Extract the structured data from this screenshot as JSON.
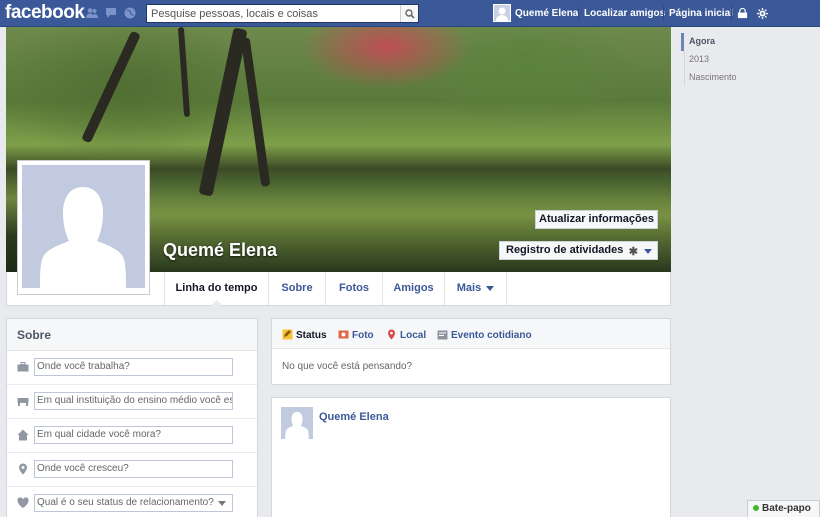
{
  "colors": {
    "brand": "#3b5998",
    "page_bg": "#e9eaed",
    "link": "#3b5998",
    "online": "#42b72a"
  },
  "topbar": {
    "logo": "facebook",
    "icons": [
      "friend-requests-icon",
      "messages-icon",
      "notifications-globe-icon"
    ],
    "search_placeholder": "Pesquise pessoas, locais e coisas",
    "user_name": "Quemé Elena",
    "find_friends": "Localizar amigos",
    "home": "Página inicial",
    "right_icons": [
      "privacy-shortcuts-icon",
      "settings-gear-icon"
    ]
  },
  "cover": {
    "update_info": "Atualizar informações",
    "activity_log": "Registro de atividades"
  },
  "profile": {
    "name": "Quemé Elena"
  },
  "tabs": [
    "Linha do tempo",
    "Sobre",
    "Fotos",
    "Amigos",
    "Mais"
  ],
  "about": {
    "title": "Sobre",
    "fields": [
      {
        "icon": "briefcase-icon",
        "placeholder": "Onde você trabalha?"
      },
      {
        "icon": "school-icon",
        "placeholder": "Em qual instituição do ensino médio você estudou?"
      },
      {
        "icon": "house-icon",
        "placeholder": "Em qual cidade você mora?"
      },
      {
        "icon": "location-pin-icon",
        "placeholder": "Onde você cresceu?"
      },
      {
        "icon": "heart-icon",
        "placeholder": "Qual é o seu status de relacionamento?"
      }
    ]
  },
  "composer": {
    "tabs": [
      "Status",
      "Foto",
      "Local",
      "Evento cotidiano"
    ],
    "prompt": "No que você está pensando?"
  },
  "story": {
    "author": "Quemé Elena"
  },
  "timeline_years": [
    "Agora",
    "2013",
    "Nascimento"
  ],
  "chat": {
    "label": "Bate-papo"
  }
}
